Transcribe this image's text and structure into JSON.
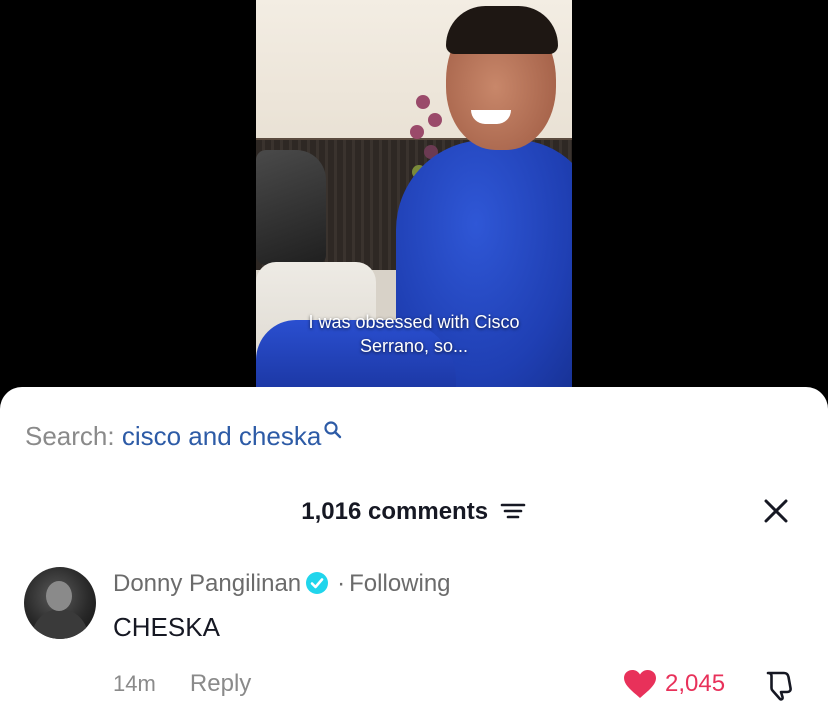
{
  "video": {
    "caption_line1": "I was obsessed with Cisco",
    "caption_line2": "Serrano, so..."
  },
  "search": {
    "prefix": "Search:",
    "term": "cisco and cheska"
  },
  "comments_panel": {
    "title": "1,016 comments",
    "filter_icon": "filter-icon",
    "close_icon": "close-icon"
  },
  "comment": {
    "author": "Donny Pangilinan",
    "separator": "·",
    "status": "Following",
    "text": "CHESKA",
    "time": "14m",
    "reply_label": "Reply",
    "likes": "2,045"
  },
  "colors": {
    "search_term": "#2d5ba6",
    "verified": "#20d5ec",
    "like": "#e8315a"
  }
}
